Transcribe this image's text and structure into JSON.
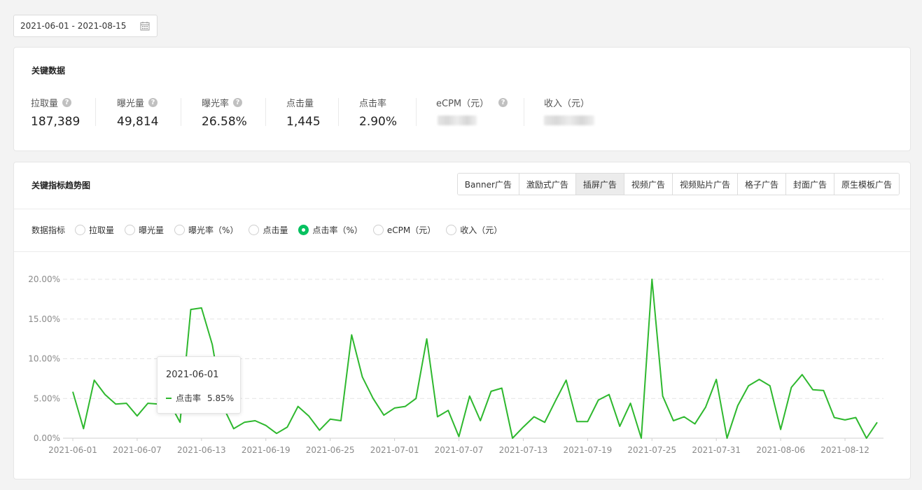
{
  "date_range": "2021-06-01 - 2021-08-15",
  "kpi": {
    "title": "关键数据",
    "items": [
      {
        "label": "拉取量",
        "value": "187,389",
        "help": true
      },
      {
        "label": "曝光量",
        "value": "49,814",
        "help": true
      },
      {
        "label": "曝光率",
        "value": "26.58%",
        "help": true
      },
      {
        "label": "点击量",
        "value": "1,445",
        "help": false
      },
      {
        "label": "点击率",
        "value": "2.90%",
        "help": false
      },
      {
        "label": "eCPM（元）",
        "value": "",
        "help": true
      },
      {
        "label": "收入（元）",
        "value": "",
        "help": false
      }
    ]
  },
  "trend": {
    "title": "关键指标趋势图",
    "tabs": [
      "Banner广告",
      "激励式广告",
      "插屏广告",
      "视频广告",
      "视频贴片广告",
      "格子广告",
      "封面广告",
      "原生模板广告"
    ],
    "active_tab": "插屏广告",
    "metrics_label": "数据指标",
    "metrics": [
      "拉取量",
      "曝光量",
      "曝光率（%）",
      "点击量",
      "点击率（%）",
      "eCPM（元）",
      "收入（元）"
    ],
    "selected_metric": "点击率（%）",
    "tooltip": {
      "date": "2021-06-01",
      "series": "点击率",
      "value": "5.85%"
    }
  },
  "colors": {
    "series": "#2eb82e",
    "accent": "#07c160"
  },
  "chart_data": {
    "type": "line",
    "ylabel": "",
    "xlabel": "",
    "ylim": [
      0,
      20
    ],
    "yticks": [
      "0.00%",
      "5.00%",
      "10.00%",
      "15.00%",
      "20.00%"
    ],
    "xticks": [
      "2021-06-01",
      "2021-06-07",
      "2021-06-13",
      "2021-06-19",
      "2021-06-25",
      "2021-07-01",
      "2021-07-07",
      "2021-07-13",
      "2021-07-19",
      "2021-07-25",
      "2021-07-31",
      "2021-08-06",
      "2021-08-12"
    ],
    "x_start": "2021-06-01",
    "x_end": "2021-08-15",
    "grid": "horizontal-dashed",
    "series": [
      {
        "name": "点击率",
        "values": [
          5.85,
          1.2,
          7.3,
          5.5,
          4.3,
          4.4,
          2.8,
          4.4,
          4.3,
          4.5,
          2.0,
          16.2,
          16.4,
          11.8,
          4.0,
          1.2,
          2.0,
          2.2,
          1.6,
          0.6,
          1.4,
          4.0,
          2.8,
          1.0,
          2.4,
          2.2,
          13.0,
          7.7,
          5.0,
          2.9,
          3.8,
          4.0,
          5.0,
          12.5,
          2.7,
          3.5,
          0.2,
          5.3,
          2.2,
          5.9,
          6.3,
          0.0,
          1.4,
          2.7,
          2.0,
          4.7,
          7.3,
          2.1,
          2.1,
          4.8,
          5.5,
          1.5,
          4.4,
          0.0,
          20.0,
          5.3,
          2.2,
          2.7,
          1.8,
          3.9,
          7.4,
          0.0,
          4.1,
          6.6,
          7.4,
          6.6,
          1.1,
          6.4,
          8.0,
          6.1,
          6.0,
          2.6,
          2.3,
          2.6,
          0.0,
          2.0
        ]
      }
    ]
  }
}
